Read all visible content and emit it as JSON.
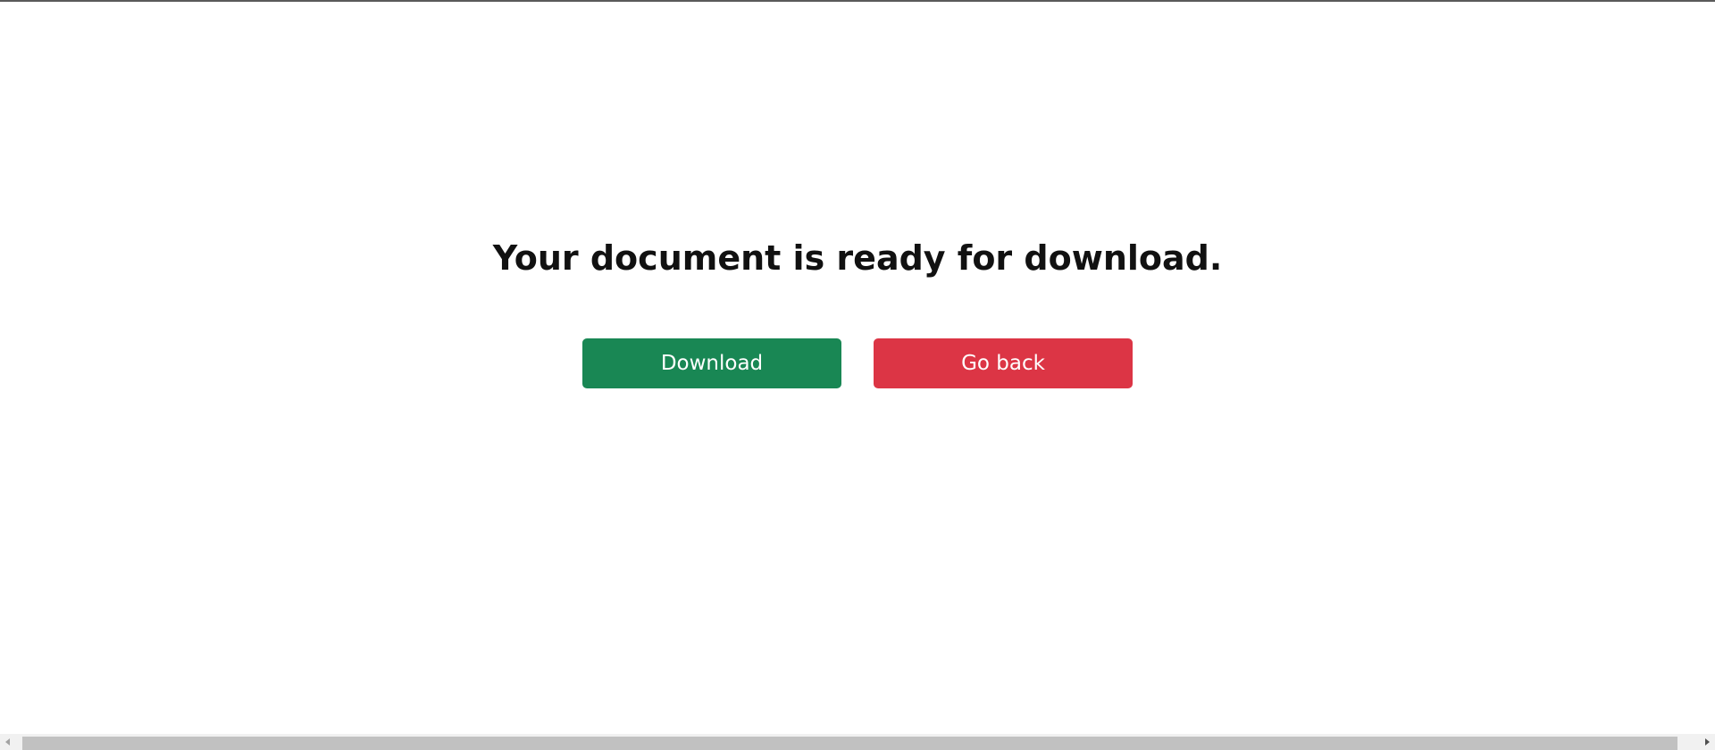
{
  "main": {
    "heading": "Your document is ready for download."
  },
  "actions": {
    "download_label": "Download",
    "go_back_label": "Go back"
  },
  "colors": {
    "download_button": "#198754",
    "go_back_button": "#dc3545"
  }
}
